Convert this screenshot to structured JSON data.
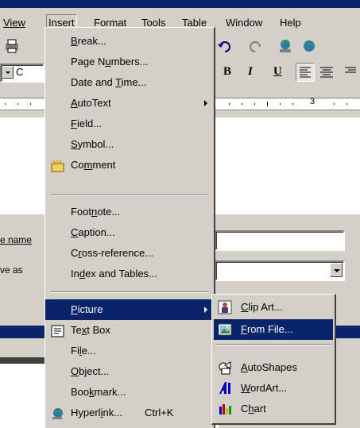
{
  "menubar": {
    "items": [
      "View",
      "Insert",
      "Format",
      "Tools",
      "Table",
      "Window",
      "Help"
    ],
    "active": "Insert"
  },
  "toolbar": {
    "style_box_letter": "C",
    "bold": "B",
    "italic": "I",
    "underline": "U"
  },
  "ruler": {
    "mark": "3"
  },
  "dialog": {
    "name_label": "e name",
    "save_as_label": "ve as"
  },
  "insert_menu": {
    "items": [
      {
        "label": "Break...",
        "u": "B"
      },
      {
        "label": "Page Numbers...",
        "u": "u"
      },
      {
        "label": "Date and Time...",
        "u": "T"
      },
      {
        "label": "AutoText",
        "u": "A",
        "submenu": true
      },
      {
        "label": "Field...",
        "u": "F"
      },
      {
        "label": "Symbol...",
        "u": "S"
      },
      {
        "label": "Comment",
        "u": "m",
        "icon": "comment-icon"
      },
      {
        "label": "Footnote...",
        "u": "n"
      },
      {
        "label": "Caption...",
        "u": "C"
      },
      {
        "label": "Cross-reference...",
        "u": "r"
      },
      {
        "label": "Index and Tables...",
        "u": "d"
      },
      {
        "label": "Picture",
        "u": "P",
        "submenu": true,
        "selected": true
      },
      {
        "label": "Text Box",
        "u": "x",
        "icon": "text-box-icon"
      },
      {
        "label": "File...",
        "u": "l"
      },
      {
        "label": "Object...",
        "u": "O"
      },
      {
        "label": "Bookmark...",
        "u": "k"
      },
      {
        "label": "Hyperlink...",
        "u": "i",
        "shortcut": "Ctrl+K",
        "icon": "hyperlink-icon"
      }
    ]
  },
  "picture_submenu": {
    "items": [
      {
        "label": "Clip Art...",
        "u": "C",
        "icon": "clip-art-icon"
      },
      {
        "label": "From File...",
        "u": "F",
        "icon": "from-file-icon",
        "selected": true
      },
      {
        "label": "AutoShapes",
        "u": "A",
        "icon": "autoshapes-icon"
      },
      {
        "label": "WordArt...",
        "u": "W",
        "icon": "wordart-icon"
      },
      {
        "label": "Chart",
        "u": "h",
        "icon": "chart-icon"
      }
    ]
  },
  "colors": {
    "face": "#d4d0c8",
    "highlight": "#0a246a",
    "shadow": "#808080"
  }
}
